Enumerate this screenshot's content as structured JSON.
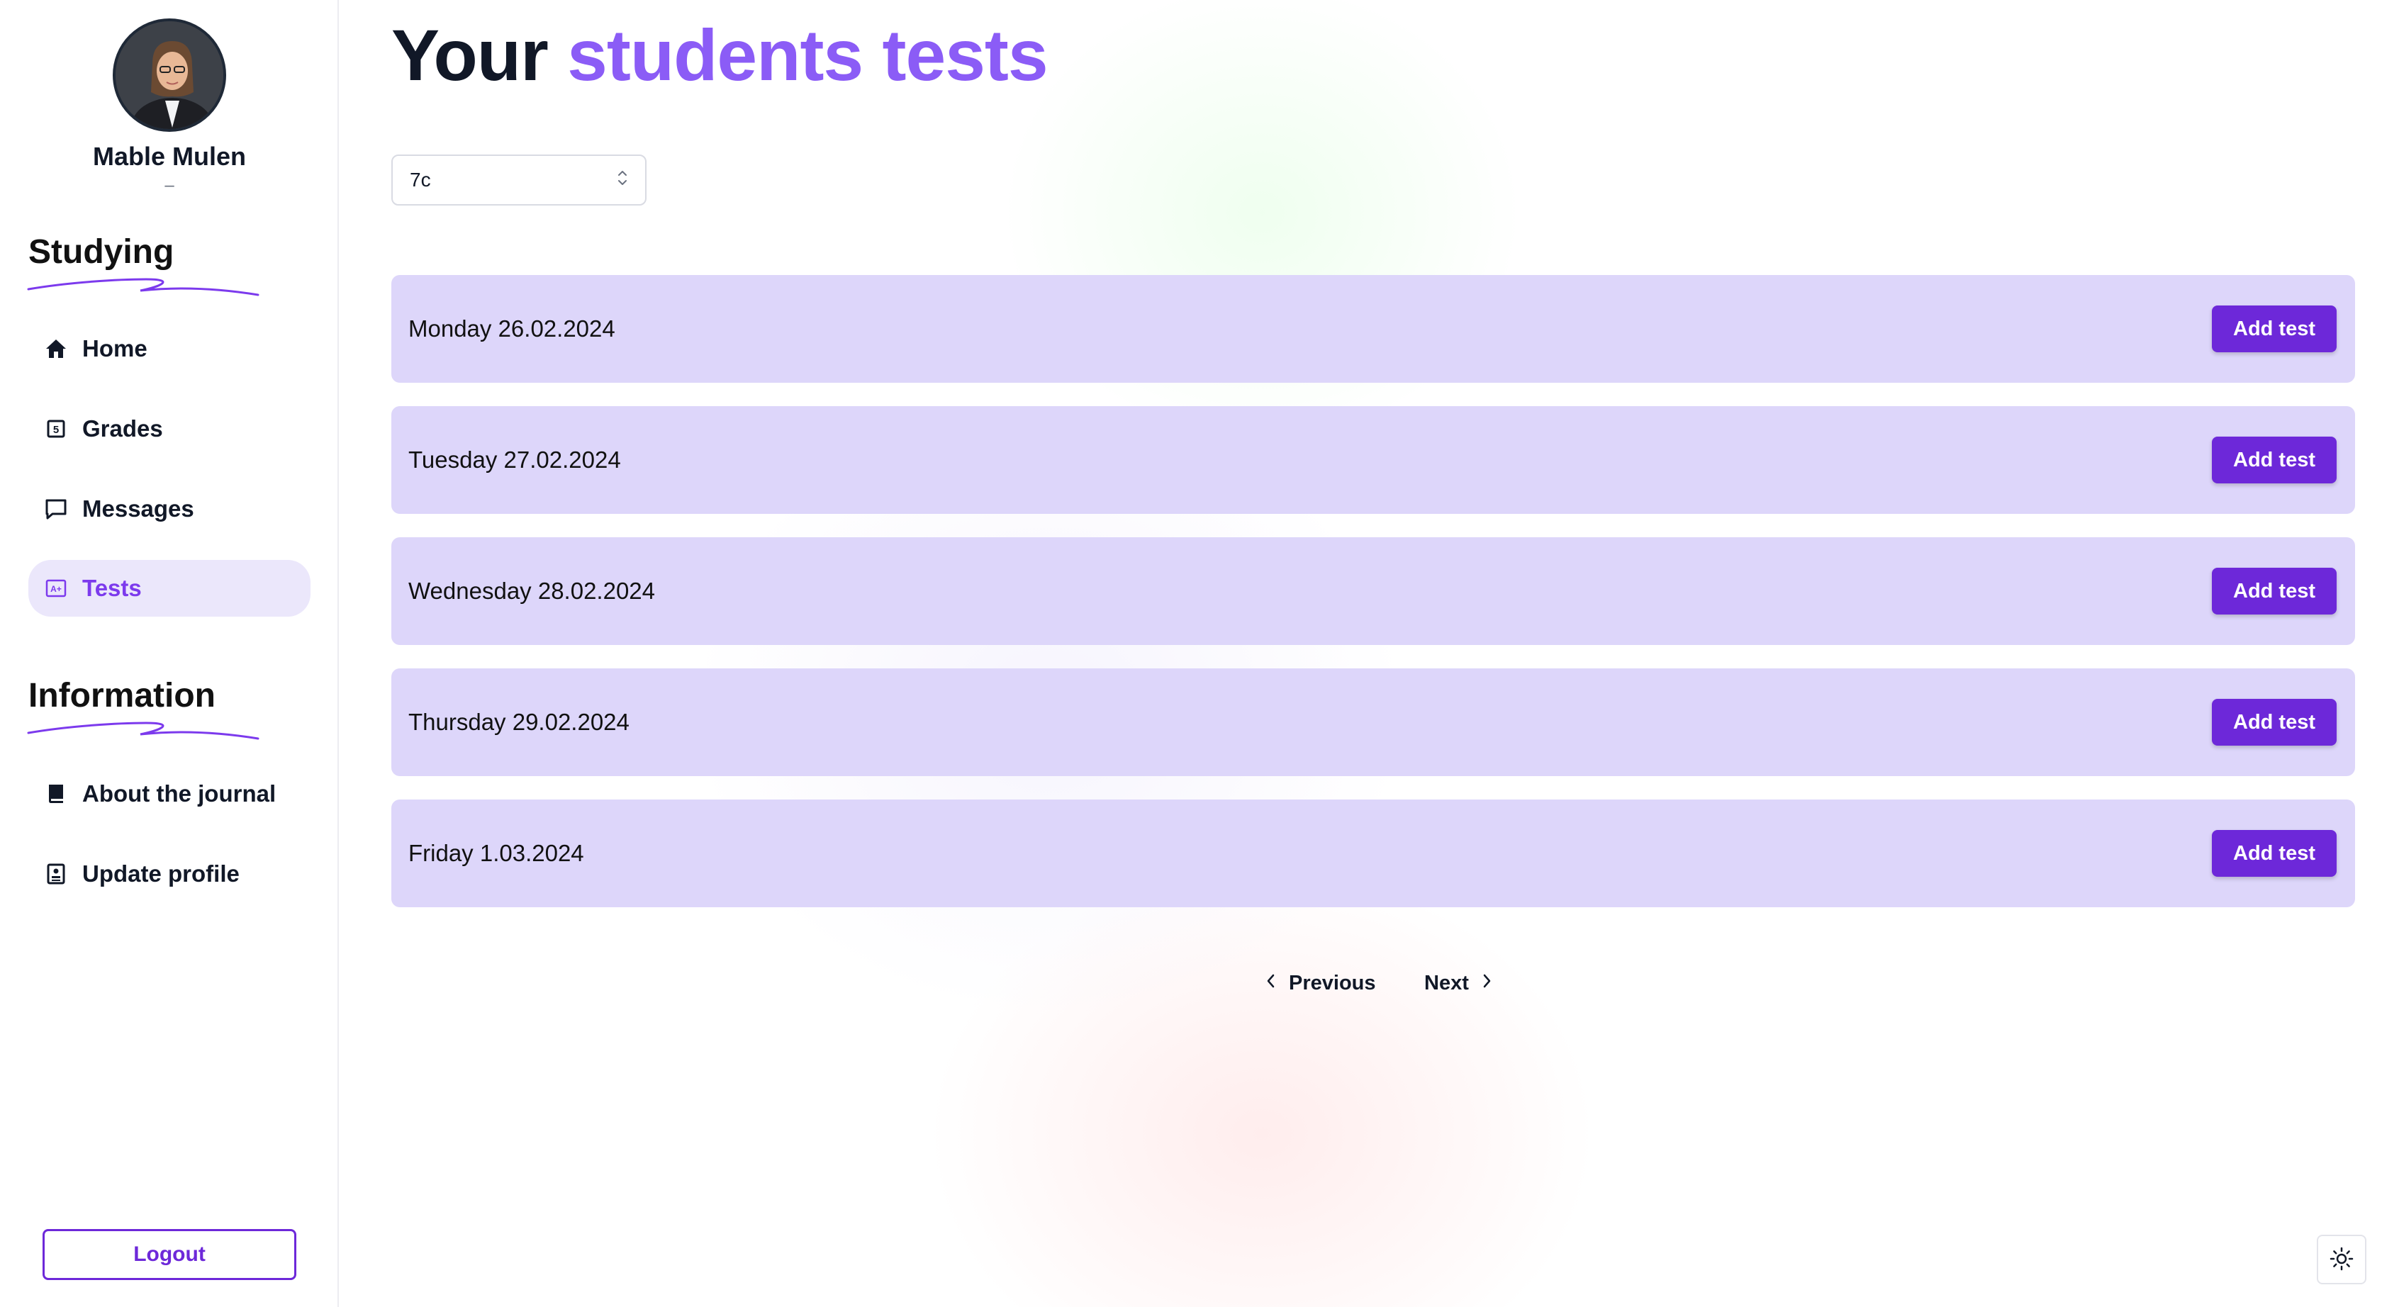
{
  "sidebar": {
    "user": {
      "name": "Mable Mulen",
      "subtitle": "–"
    },
    "sections": [
      {
        "title": "Studying"
      },
      {
        "title": "Information"
      }
    ],
    "studying_items": [
      {
        "label": "Home",
        "icon": "home-icon"
      },
      {
        "label": "Grades",
        "icon": "grades-icon"
      },
      {
        "label": "Messages",
        "icon": "message-icon"
      },
      {
        "label": "Tests",
        "icon": "test-icon",
        "active": true
      }
    ],
    "information_items": [
      {
        "label": "About the journal",
        "icon": "book-icon"
      },
      {
        "label": "Update profile",
        "icon": "profile-icon"
      }
    ],
    "logout_label": "Logout"
  },
  "main": {
    "title_prefix": "Your",
    "title_accent": "students tests",
    "class_select": {
      "value": "7c"
    },
    "days": [
      {
        "label": "Monday 26.02.2024",
        "button": "Add test"
      },
      {
        "label": "Tuesday 27.02.2024",
        "button": "Add test"
      },
      {
        "label": "Wednesday 28.02.2024",
        "button": "Add test"
      },
      {
        "label": "Thursday 29.02.2024",
        "button": "Add test"
      },
      {
        "label": "Friday 1.03.2024",
        "button": "Add test"
      }
    ],
    "pagination": {
      "previous": "Previous",
      "next": "Next"
    }
  },
  "colors": {
    "accent": "#8b5cf6",
    "primary_button": "#6d28d9",
    "row_background": "#ddd6fa",
    "active_nav_background": "#ebe7fb"
  }
}
